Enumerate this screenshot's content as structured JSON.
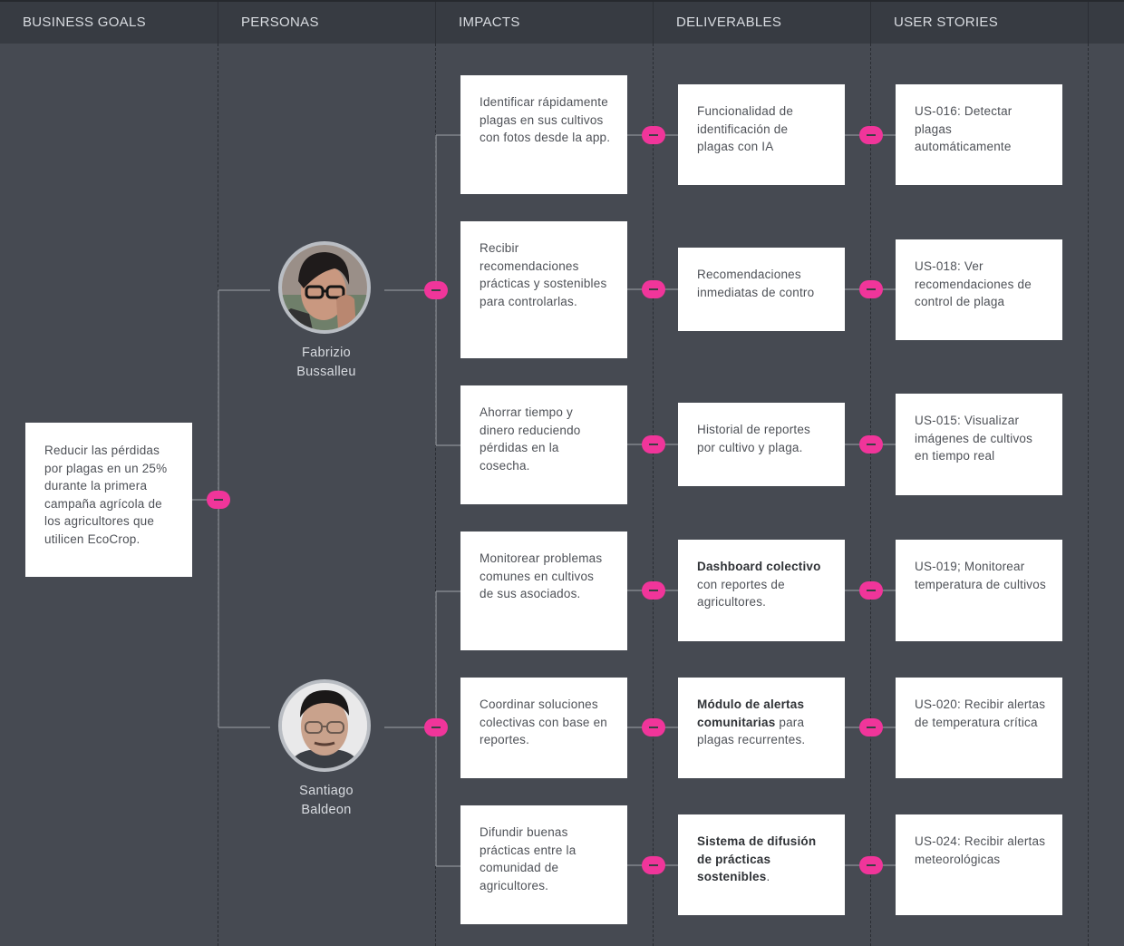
{
  "columns": [
    "BUSINESS GOALS",
    "PERSONAS",
    "IMPACTS",
    "DELIVERABLES",
    "USER STORIES"
  ],
  "goal": {
    "text": "Reducir las pérdidas por plagas en un 25% durante la primera campaña agrícola de los agricultores que utilicen EcoCrop."
  },
  "personas": [
    {
      "name_line1": "Fabrizio",
      "name_line2": "Bussalleu"
    },
    {
      "name_line1": "Santiago",
      "name_line2": "Baldeon"
    }
  ],
  "impacts": [
    {
      "text": "Identificar rápidamente plagas en sus cultivos con fotos desde la app."
    },
    {
      "text": "Recibir recomendaciones prácticas y sostenibles para controlarlas."
    },
    {
      "text": "Ahorrar tiempo y dinero reduciendo pérdidas en la cosecha."
    },
    {
      "text": "Monitorear problemas comunes en cultivos de sus asociados."
    },
    {
      "text": "Coordinar soluciones colectivas con base en reportes."
    },
    {
      "text": "Difundir buenas prácticas entre la comunidad de agricultores."
    }
  ],
  "deliverables": [
    {
      "bold": "",
      "text": "Funcionalidad de identificación de plagas con IA"
    },
    {
      "bold": "",
      "text": "Recomendaciones inmediatas de contro"
    },
    {
      "bold": "",
      "text": "Historial de reportes por cultivo y plaga."
    },
    {
      "bold": "Dashboard colectivo",
      "text": " con reportes de agricultores."
    },
    {
      "bold": "Módulo de alertas comunitarias",
      "text": " para plagas recurrentes."
    },
    {
      "bold": "Sistema de difusión de prácticas sostenibles",
      "text": "."
    }
  ],
  "user_stories": [
    {
      "text": "US-016:  Detectar plagas automáticamente"
    },
    {
      "text": "US-018:  Ver recomendaciones de control de plaga"
    },
    {
      "text": "US-015: Visualizar imágenes de cultivos en tiempo real"
    },
    {
      "text": "US-019;  Monitorear temperatura de cultivos"
    },
    {
      "text": "US-020:  Recibir alertas de temperatura crítica"
    },
    {
      "text": "US-024:  Recibir alertas meteorológicas"
    }
  ],
  "colors": {
    "background": "#464a52",
    "header": "#373b42",
    "accent": "#f0359a",
    "card": "#ffffff",
    "connector": "#8d9197"
  },
  "icons": [
    "collapse-toggle-icon",
    "persona-avatar"
  ]
}
